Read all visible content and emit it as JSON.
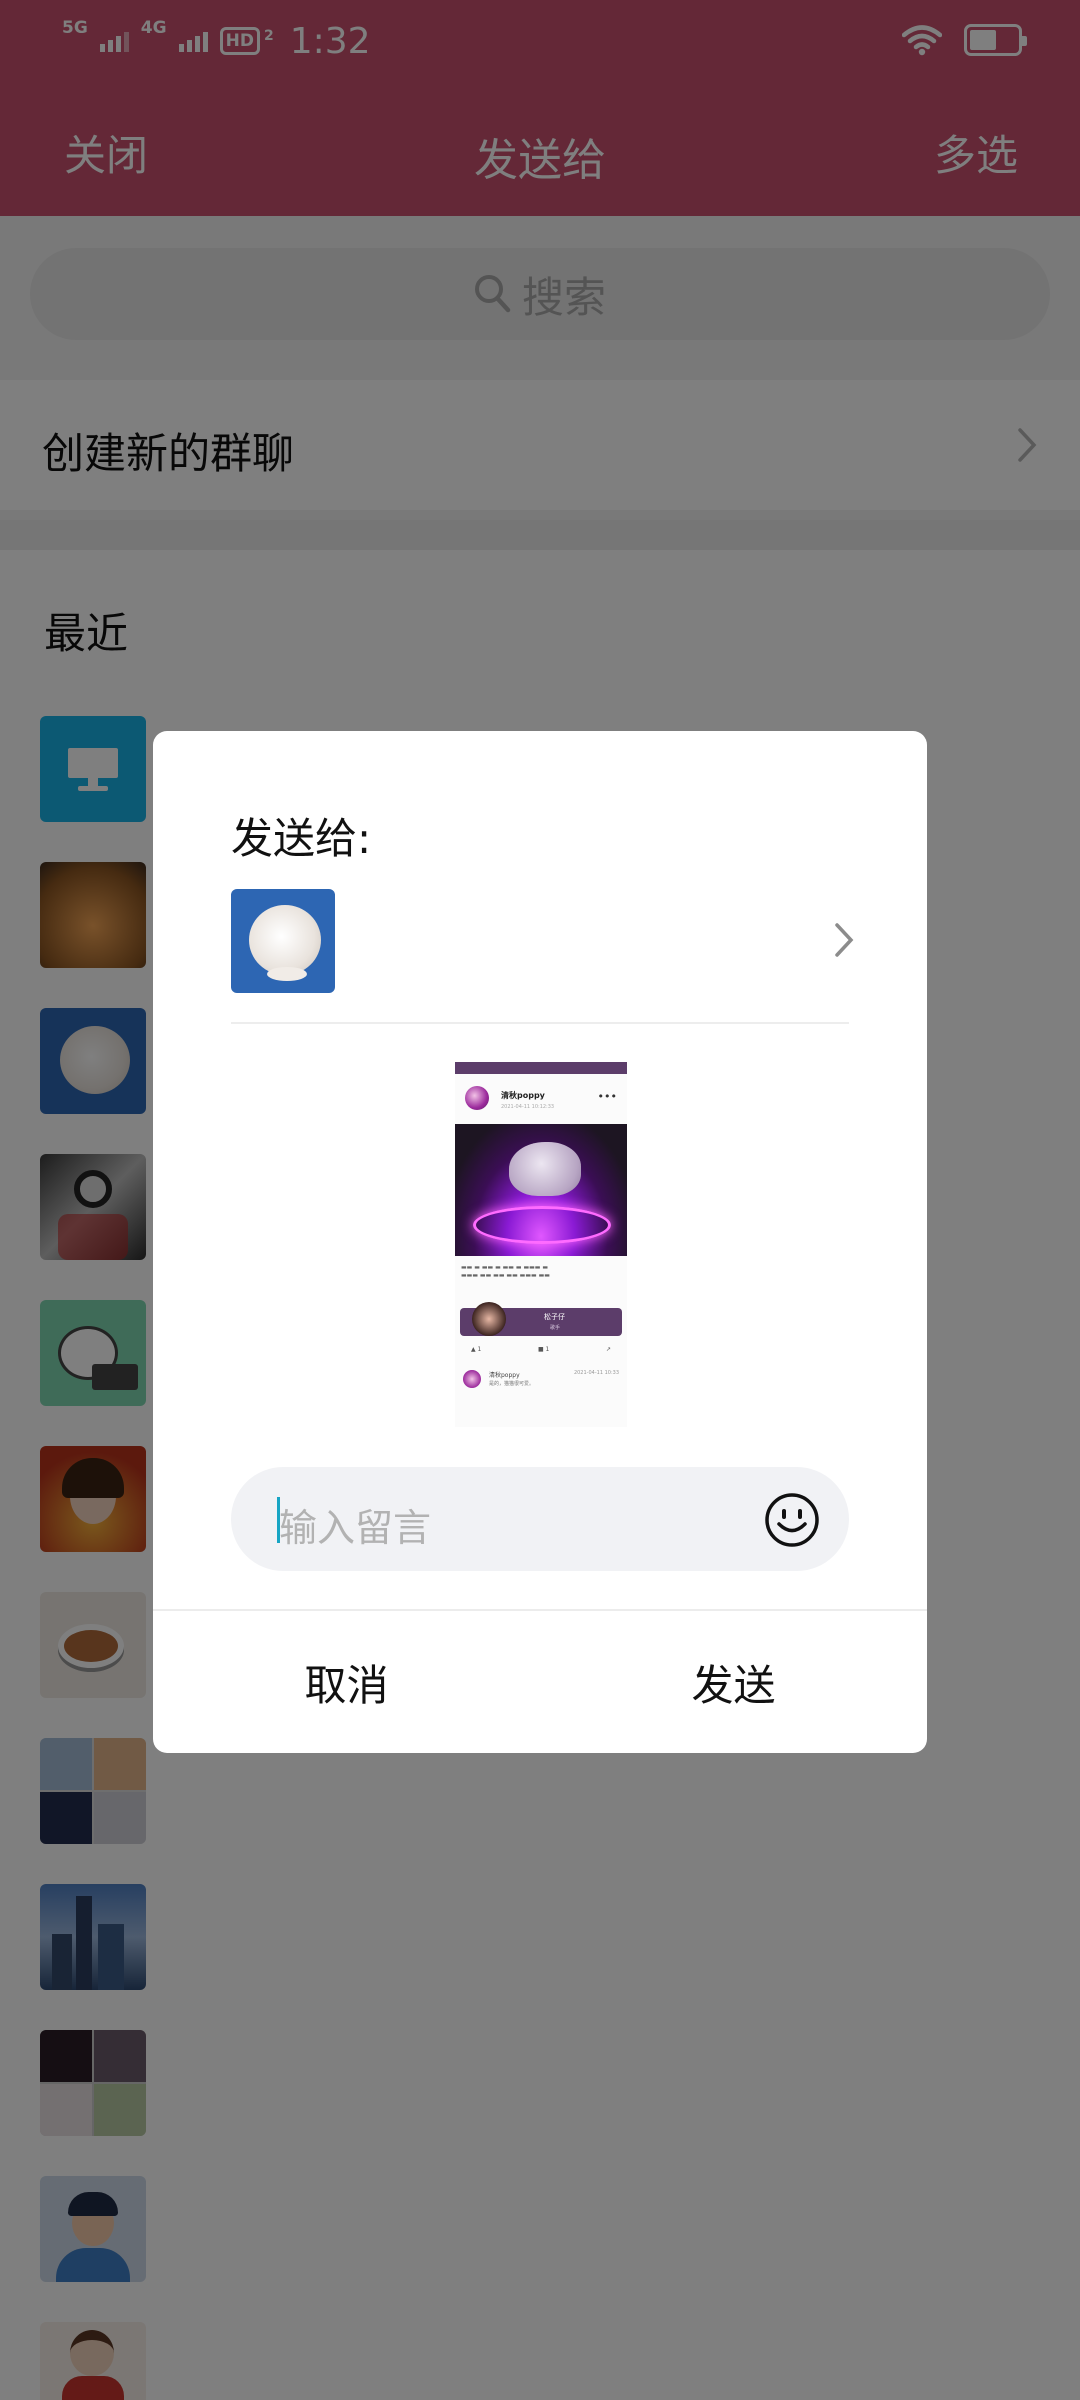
{
  "status_bar": {
    "network_1": "5G",
    "network_2": "4G",
    "hd_badge": "HD",
    "hd_sub": "2",
    "time": "1:32",
    "battery_level": 0.5
  },
  "header": {
    "close_label": "关闭",
    "title": "发送给",
    "multi_select_label": "多选"
  },
  "search": {
    "placeholder": "搜索"
  },
  "new_group": {
    "label": "创建新的群聊"
  },
  "recent": {
    "title": "最近"
  },
  "dialog": {
    "title": "发送给:",
    "preview": {
      "author": "清秋poppy",
      "post_time": "2021-04-11 10:12:33",
      "song_title": "松子仔",
      "song_subtitle": "歌手",
      "likes": "1",
      "comments": "1",
      "comment_author": "清秋poppy",
      "comment_time": "2021-04-11 10:33",
      "comment_text": "是的，猫猫很可爱。"
    },
    "input_placeholder": "输入留言",
    "cancel_label": "取消",
    "send_label": "发送"
  },
  "colors": {
    "header_bg": "#c8506e",
    "cursor": "#17a5c4"
  }
}
